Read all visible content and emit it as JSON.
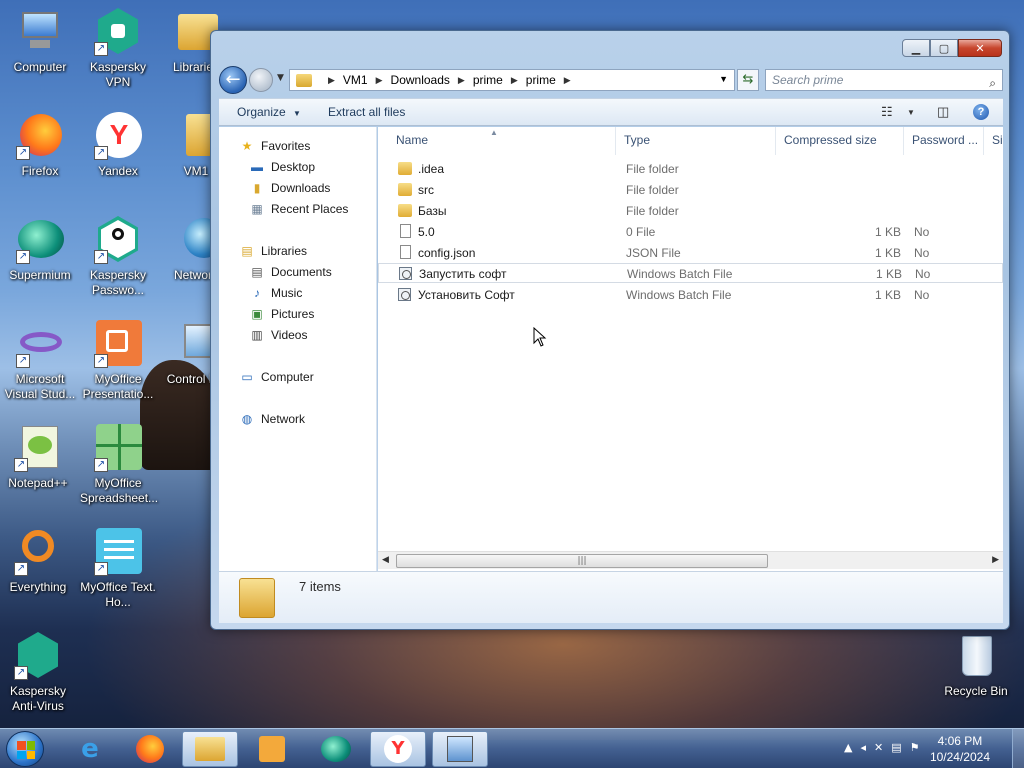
{
  "desktop": {
    "icons": [
      {
        "label": "Computer",
        "icon": "computer-icon"
      },
      {
        "label": "Kaspersky VPN",
        "icon": "kaspersky-vpn-icon"
      },
      {
        "label": "Libraries",
        "icon": "libraries-icon"
      },
      {
        "label": "Firefox",
        "icon": "firefox-icon"
      },
      {
        "label": "Yandex",
        "icon": "yandex-icon"
      },
      {
        "label": "VM1",
        "icon": "folder-icon"
      },
      {
        "label": "Supermium",
        "icon": "supermium-icon"
      },
      {
        "label": "Kaspersky Passwo...",
        "icon": "kaspersky-password-icon"
      },
      {
        "label": "Network",
        "icon": "network-icon"
      },
      {
        "label": "Microsoft Visual Stud...",
        "icon": "visual-studio-icon"
      },
      {
        "label": "MyOffice Presentatio...",
        "icon": "myoffice-presentation-icon"
      },
      {
        "label": "Control P...",
        "icon": "control-panel-icon"
      },
      {
        "label": "Notepad++",
        "icon": "notepadpp-icon"
      },
      {
        "label": "MyOffice Spreadsheet...",
        "icon": "myoffice-spreadsheet-icon"
      },
      {
        "label": "Everything",
        "icon": "everything-icon"
      },
      {
        "label": "MyOffice Text. Ho...",
        "icon": "myoffice-text-icon"
      },
      {
        "label": "Kaspersky Anti-Virus",
        "icon": "kaspersky-antivirus-icon"
      },
      {
        "label": "Recycle Bin",
        "icon": "recycle-bin-icon"
      }
    ]
  },
  "window": {
    "address": {
      "crumbs": [
        "VM1",
        "Downloads",
        "prime",
        "prime"
      ]
    },
    "search": {
      "placeholder": "Search prime"
    },
    "toolbar": {
      "organize": "Organize",
      "extract_all": "Extract all files"
    },
    "nav": {
      "favorites": "Favorites",
      "desktop": "Desktop",
      "downloads": "Downloads",
      "recent": "Recent Places",
      "libraries": "Libraries",
      "documents": "Documents",
      "music": "Music",
      "pictures": "Pictures",
      "videos": "Videos",
      "computer": "Computer",
      "network": "Network"
    },
    "columns": {
      "name": "Name",
      "type": "Type",
      "compressed": "Compressed size",
      "password": "Password ...",
      "size": "Si"
    },
    "files": [
      {
        "name": ".idea",
        "type": "File folder",
        "compressed": "",
        "password": "",
        "kind": "folder"
      },
      {
        "name": "src",
        "type": "File folder",
        "compressed": "",
        "password": "",
        "kind": "folder"
      },
      {
        "name": "Базы",
        "type": "File folder",
        "compressed": "",
        "password": "",
        "kind": "folder"
      },
      {
        "name": "5.0",
        "type": "0 File",
        "compressed": "1 KB",
        "password": "No",
        "kind": "file"
      },
      {
        "name": "config.json",
        "type": "JSON File",
        "compressed": "1 KB",
        "password": "No",
        "kind": "file"
      },
      {
        "name": "Запустить софт",
        "type": "Windows Batch File",
        "compressed": "1 KB",
        "password": "No",
        "kind": "bat"
      },
      {
        "name": "Установить Софт",
        "type": "Windows Batch File",
        "compressed": "1 KB",
        "password": "No",
        "kind": "bat"
      }
    ],
    "status": {
      "items": "7 items"
    }
  },
  "taskbar": {
    "apps": [
      "internet-explorer-icon",
      "firefox-icon",
      "explorer-icon",
      "media-player-icon",
      "supermium-icon",
      "yandex-icon",
      "network-tool-icon"
    ],
    "clock": {
      "time": "4:06 PM",
      "date": "10/24/2024"
    }
  }
}
